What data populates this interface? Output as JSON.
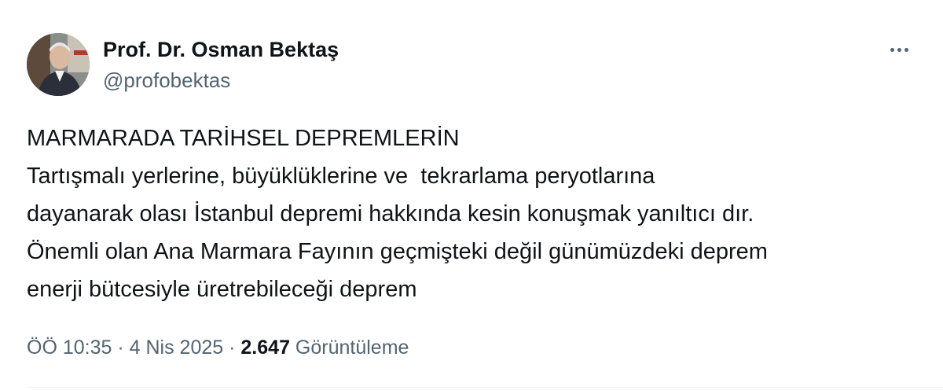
{
  "author": {
    "display_name": "Prof. Dr. Osman Bektaş",
    "handle": "@profobektas"
  },
  "tweet": {
    "lines": [
      "MARMARADA TARİHSEL DEPREMLERİN",
      "Tartışmalı yerlerine, büyüklüklerine ve  tekrarlama peryotlarına",
      "dayanarak olası İstanbul depremi hakkında kesin konuşmak yanıltıcı dır.",
      "Önemli olan Ana Marmara Fayının geçmişteki değil günümüzdeki deprem",
      "enerji bütcesiyle üretrebileceği deprem"
    ]
  },
  "meta": {
    "time": "ÖÖ 10:35",
    "separator": "·",
    "date": "4 Nis 2025",
    "views_count": "2.647",
    "views_label": "Görüntüleme"
  },
  "icons": {
    "more": "more-horizontal-icon"
  },
  "colors": {
    "primary_text": "#0f1419",
    "secondary_text": "#536471",
    "divider": "#eff3f4"
  }
}
